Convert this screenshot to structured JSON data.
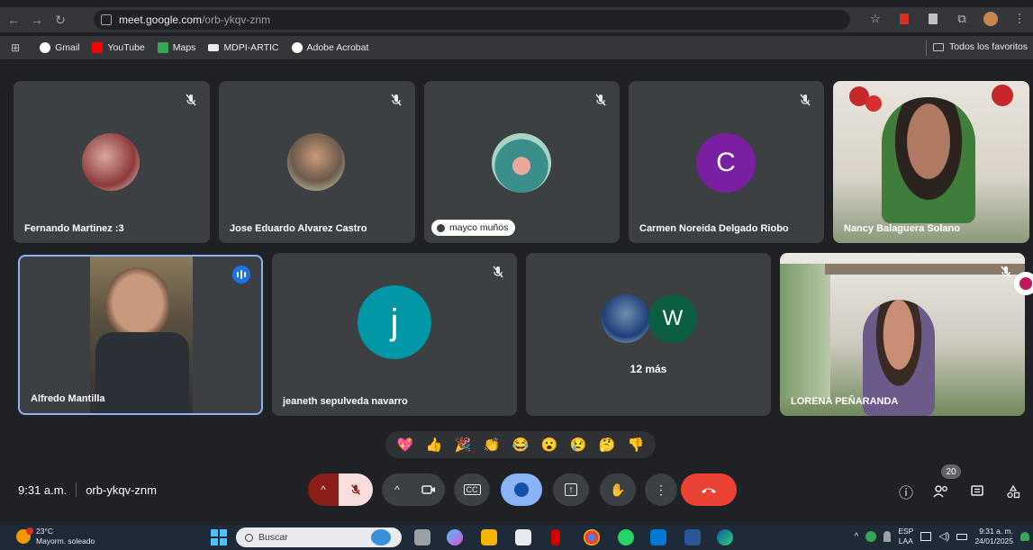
{
  "browser": {
    "url_host": "meet.google.com",
    "url_path": "/orb-ykqv-znm",
    "bookmarks": [
      {
        "label": "Gmail",
        "color": "#ffffff"
      },
      {
        "label": "YouTube",
        "color": "#ff0000"
      },
      {
        "label": "Maps",
        "color": "#34a853"
      },
      {
        "label": "MDPI-ARTIC",
        "color": "#ffffff"
      },
      {
        "label": "Adobe Acrobat",
        "color": "#ffffff"
      }
    ],
    "all_bookmarks_label": "Todos los favoritos"
  },
  "participants": [
    {
      "name": "Fernando Martinez :3",
      "muted": true
    },
    {
      "name": "Jose Eduardo Alvarez Castro",
      "muted": true
    },
    {
      "name": "mayco muños",
      "muted": true
    },
    {
      "name": "Carmen Noreida Delgado Riobo",
      "muted": true,
      "avatar_letter": "C",
      "avatar_color": "#7b1fa2"
    },
    {
      "name": "Nancy Balaguera Solano",
      "muted": false
    },
    {
      "name": "Alfredo Mantilla",
      "speaking": true
    },
    {
      "name": "jeaneth sepulveda navarro",
      "muted": true,
      "avatar_letter": "j",
      "avatar_color": "#0097a7"
    },
    {
      "name": "12 más",
      "avatar_letter": "W",
      "avatar_color": "#0b5e3f"
    },
    {
      "name": "LORENA PEÑARANDA",
      "muted": true
    }
  ],
  "reactions": [
    "💖",
    "👍",
    "🎉",
    "👏",
    "😂",
    "😮",
    "😢",
    "🤔",
    "👎"
  ],
  "meeting": {
    "time": "9:31 a.m.",
    "code": "orb-ykqv-znm",
    "people_count": "20"
  },
  "colors": {
    "end_call": "#ea4335",
    "mic_off_bg": "#f9dedc",
    "mic_chevron_bg": "#8c1d18",
    "reactions_active": "#8ab4f8",
    "speaking_ring": "#8ab4f8"
  },
  "taskbar": {
    "weather_temp": "23°C",
    "weather_desc": "Mayorm. soleado",
    "search_placeholder": "Buscar",
    "lang_top": "ESP",
    "lang_bottom": "LAA",
    "clock_time": "9:31 a. m.",
    "clock_date": "24/01/2025"
  }
}
